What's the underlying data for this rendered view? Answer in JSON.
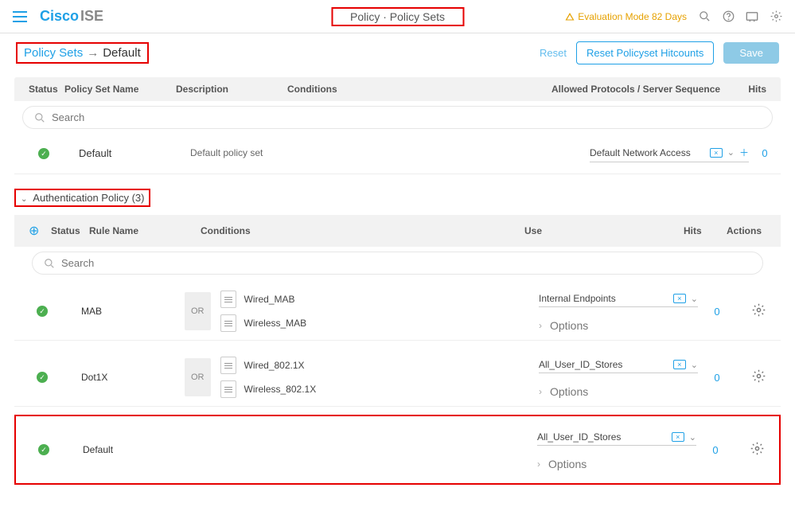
{
  "header": {
    "brand": "Cisco",
    "product": "ISE",
    "page_title": "Policy · Policy Sets",
    "eval_text": "Evaluation Mode 82 Days"
  },
  "breadcrumb": {
    "parent": "Policy Sets",
    "current": "Default"
  },
  "buttons": {
    "reset": "Reset",
    "reset_hitcounts": "Reset Policyset Hitcounts",
    "save": "Save"
  },
  "ps_columns": {
    "status": "Status",
    "name": "Policy Set Name",
    "desc": "Description",
    "cond": "Conditions",
    "allowed": "Allowed Protocols / Server Sequence",
    "hits": "Hits"
  },
  "search_placeholder": "Search",
  "policy_set_row": {
    "name": "Default",
    "desc": "Default policy set",
    "allowed": "Default Network Access",
    "hits": "0"
  },
  "section": {
    "auth_title": "Authentication Policy (3)"
  },
  "auth_columns": {
    "status": "Status",
    "rule": "Rule Name",
    "cond": "Conditions",
    "use": "Use",
    "hits": "Hits",
    "actions": "Actions"
  },
  "or_label": "OR",
  "options_label": "Options",
  "auth_rules": [
    {
      "name": "MAB",
      "conditions": [
        "Wired_MAB",
        "Wireless_MAB"
      ],
      "use": "Internal Endpoints",
      "hits": "0"
    },
    {
      "name": "Dot1X",
      "conditions": [
        "Wired_802.1X",
        "Wireless_802.1X"
      ],
      "use": "All_User_ID_Stores",
      "hits": "0"
    },
    {
      "name": "Default",
      "conditions": [],
      "use": "All_User_ID_Stores",
      "hits": "0"
    }
  ]
}
